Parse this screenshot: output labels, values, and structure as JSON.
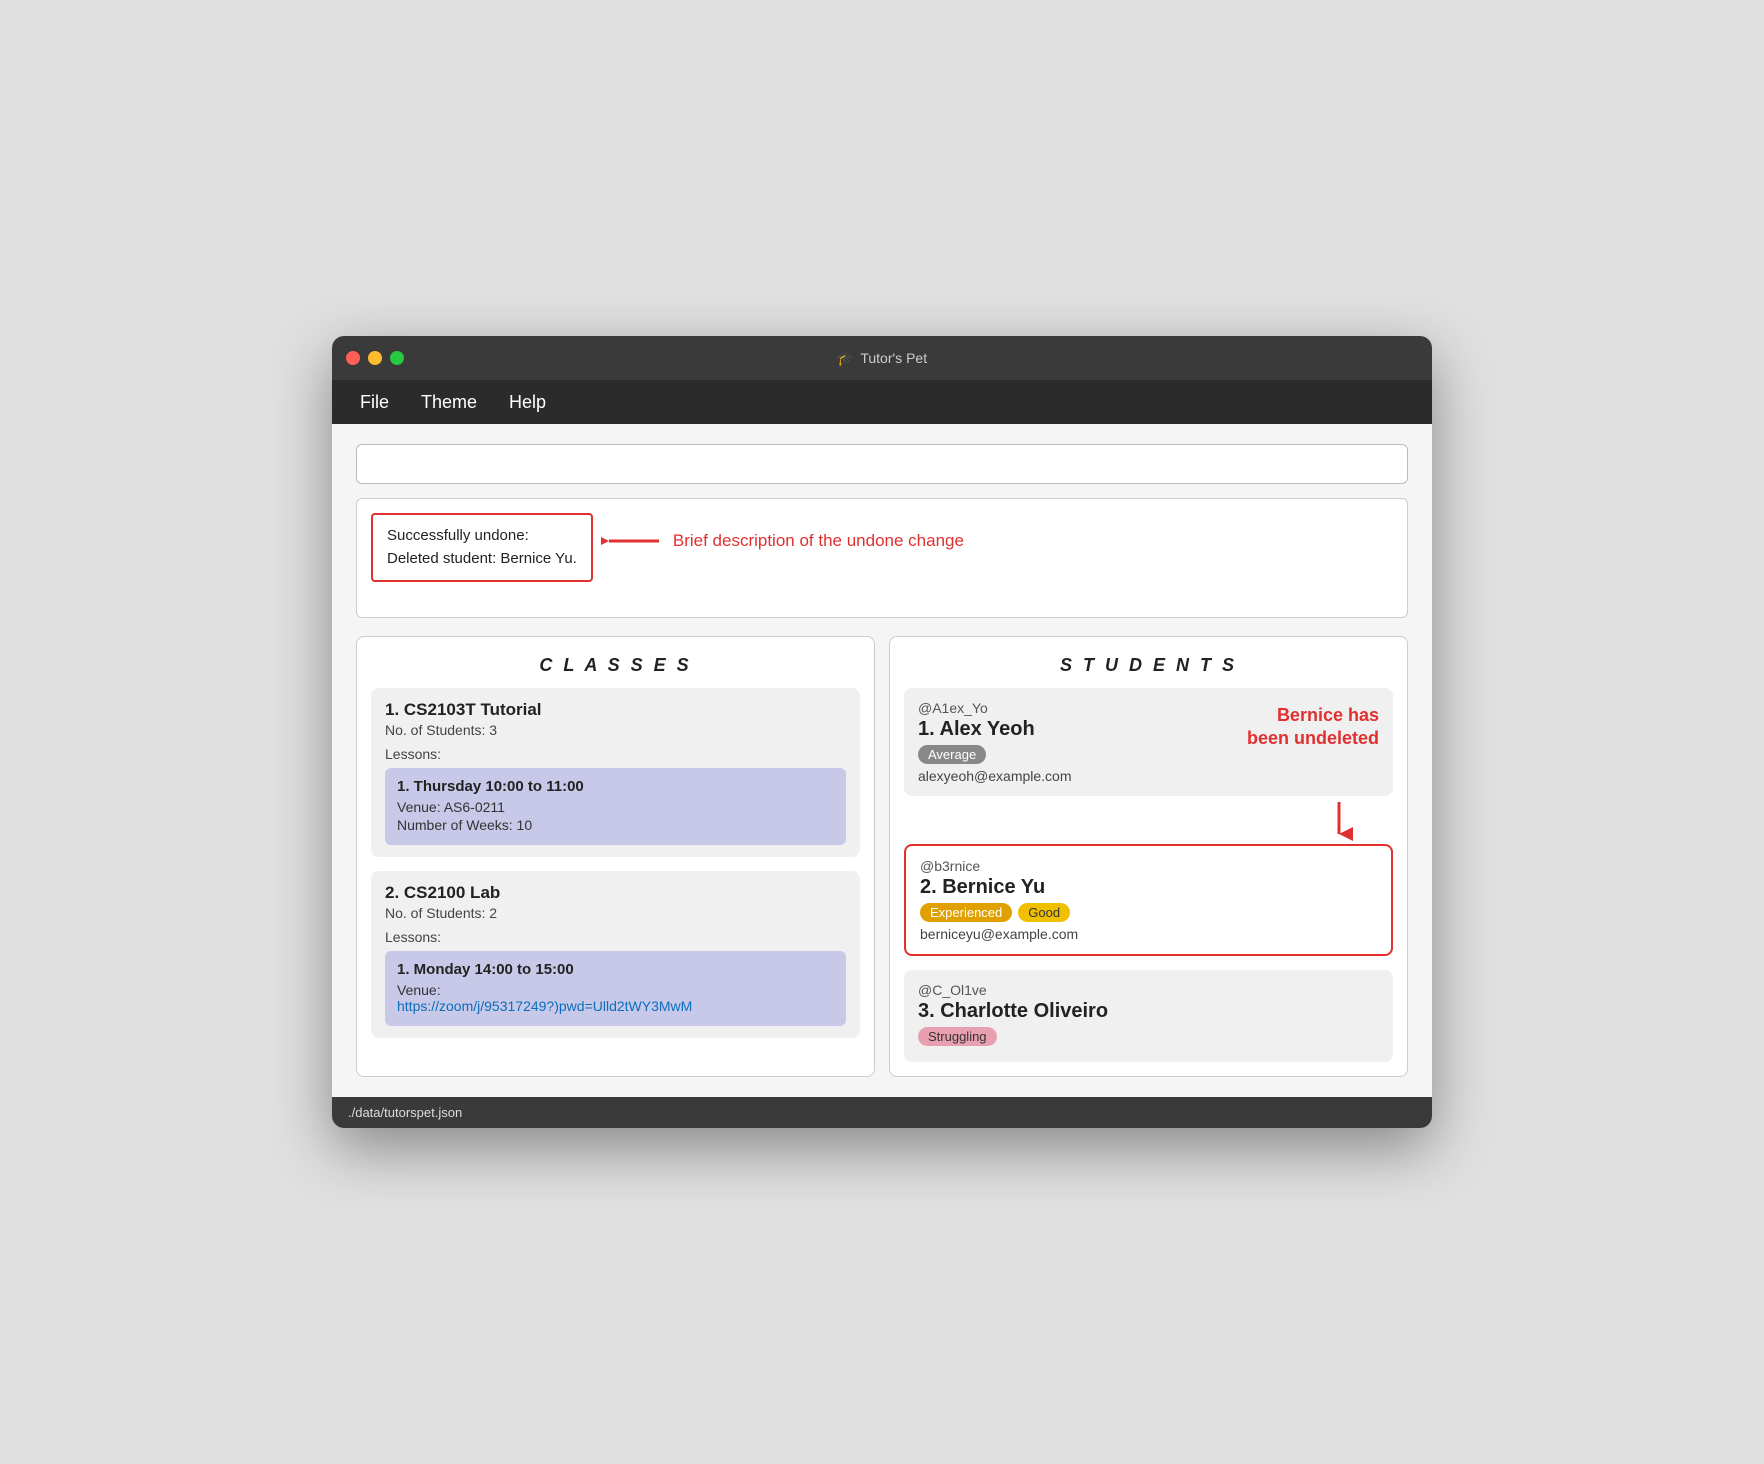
{
  "window": {
    "title": "Tutor's Pet",
    "title_icon": "🎓"
  },
  "menu": {
    "items": [
      {
        "id": "file",
        "label": "File"
      },
      {
        "id": "theme",
        "label": "Theme"
      },
      {
        "id": "help",
        "label": "Help"
      }
    ]
  },
  "command_input": {
    "placeholder": "",
    "value": ""
  },
  "response": {
    "status": "Successfully undone:",
    "detail": "Deleted student: Bernice Yu.",
    "annotation": "Brief description of the undone change"
  },
  "classes_panel": {
    "header": "C L A S S E S",
    "classes": [
      {
        "number": 1,
        "name": "CS2103T Tutorial",
        "student_count_label": "No. of Students:",
        "student_count": "3",
        "lessons_label": "Lessons:",
        "lessons": [
          {
            "number": 1,
            "schedule": "Thursday 10:00 to 11:00",
            "venue_label": "Venue:",
            "venue": "AS6-0211",
            "weeks_label": "Number of Weeks:",
            "weeks": "10"
          }
        ]
      },
      {
        "number": 2,
        "name": "CS2100 Lab",
        "student_count_label": "No. of Students:",
        "student_count": "2",
        "lessons_label": "Lessons:",
        "lessons": [
          {
            "number": 1,
            "schedule": "Monday 14:00 to 15:00",
            "venue_label": "Venue:",
            "venue": "https://zoom/j/95317249?)pwd=Ulld2tWY3MwM",
            "weeks_label": null,
            "weeks": null
          }
        ]
      }
    ]
  },
  "students_panel": {
    "header": "S T U D E N T S",
    "annotation": "Bernice has\nbeen undeleted",
    "students": [
      {
        "id": 1,
        "handle": "@A1ex_Yo",
        "name": "Alex Yeoh",
        "number": 1,
        "tags": [
          {
            "label": "Average",
            "class": "average"
          }
        ],
        "email": "alexyeoh@example.com",
        "highlighted": false
      },
      {
        "id": 2,
        "handle": "@b3rnice",
        "name": "Bernice Yu",
        "number": 2,
        "tags": [
          {
            "label": "Experienced",
            "class": "experienced"
          },
          {
            "label": "Good",
            "class": "good"
          }
        ],
        "email": "berniceyu@example.com",
        "highlighted": true
      },
      {
        "id": 3,
        "handle": "@C_Ol1ve",
        "name": "Charlotte Oliveiro",
        "number": 3,
        "tags": [
          {
            "label": "Struggling",
            "class": "struggling"
          }
        ],
        "email": null,
        "highlighted": false
      }
    ]
  },
  "status_bar": {
    "text": "./data/tutorspet.json"
  }
}
